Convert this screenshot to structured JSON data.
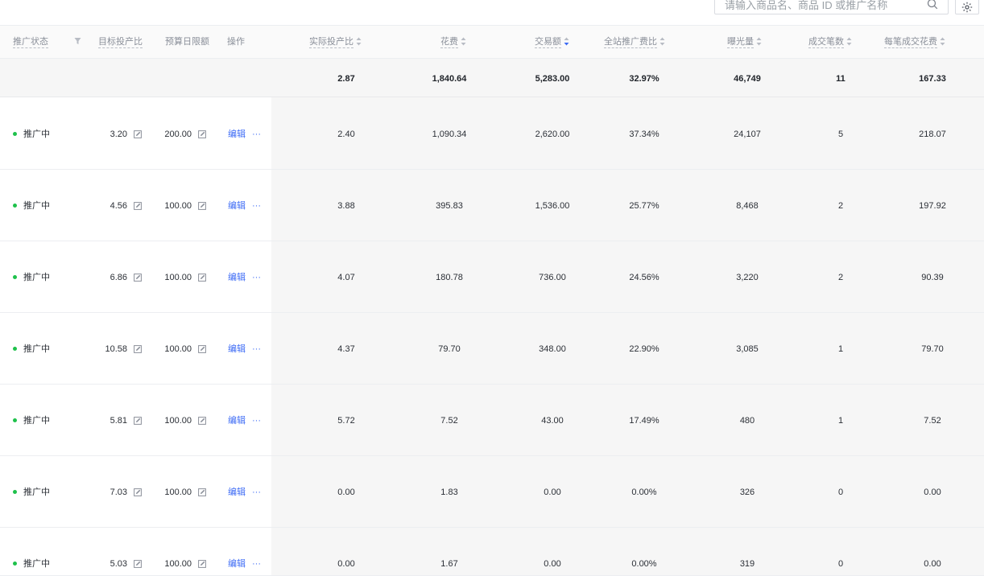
{
  "search": {
    "placeholder": "请输入商品名、商品 ID 或推广名称"
  },
  "colors": {
    "accent": "#3d6bf5",
    "status_active": "#1ec14b",
    "shade": "#f6f6f6"
  },
  "icons": {
    "search": "search-icon",
    "settings": "settings-icon",
    "filter": "filter-icon",
    "sort": "sort-icon",
    "edit": "edit-icon",
    "more": "more-icon"
  },
  "columns": {
    "status": "推广状态",
    "target_roi": "目标投产比",
    "daily_budget": "预算日限额",
    "action": "操作",
    "actual_roi": "实际投产比",
    "cost": "花费",
    "gmv": "交易额",
    "site_ratio": "全站推广费比",
    "impressions": "曝光量",
    "orders": "成交笔数",
    "cost_per_order": "每笔成交花费"
  },
  "summary": {
    "actual_roi": "2.87",
    "cost": "1,840.64",
    "gmv": "5,283.00",
    "site_ratio": "32.97%",
    "impressions": "46,749",
    "orders": "11",
    "cost_per_order": "167.33"
  },
  "rows": [
    {
      "status": "推广中",
      "target_roi": "3.20",
      "daily_budget": "200.00",
      "edit_label": "编辑",
      "more_label": "···",
      "actual_roi": "2.40",
      "cost": "1,090.34",
      "gmv": "2,620.00",
      "site_ratio": "37.34%",
      "impressions": "24,107",
      "orders": "5",
      "cost_per_order": "218.07"
    },
    {
      "status": "推广中",
      "target_roi": "4.56",
      "daily_budget": "100.00",
      "edit_label": "编辑",
      "more_label": "···",
      "actual_roi": "3.88",
      "cost": "395.83",
      "gmv": "1,536.00",
      "site_ratio": "25.77%",
      "impressions": "8,468",
      "orders": "2",
      "cost_per_order": "197.92"
    },
    {
      "status": "推广中",
      "target_roi": "6.86",
      "daily_budget": "100.00",
      "edit_label": "编辑",
      "more_label": "···",
      "actual_roi": "4.07",
      "cost": "180.78",
      "gmv": "736.00",
      "site_ratio": "24.56%",
      "impressions": "3,220",
      "orders": "2",
      "cost_per_order": "90.39"
    },
    {
      "status": "推广中",
      "target_roi": "10.58",
      "daily_budget": "100.00",
      "edit_label": "编辑",
      "more_label": "···",
      "actual_roi": "4.37",
      "cost": "79.70",
      "gmv": "348.00",
      "site_ratio": "22.90%",
      "impressions": "3,085",
      "orders": "1",
      "cost_per_order": "79.70"
    },
    {
      "status": "推广中",
      "target_roi": "5.81",
      "daily_budget": "100.00",
      "edit_label": "编辑",
      "more_label": "···",
      "actual_roi": "5.72",
      "cost": "7.52",
      "gmv": "43.00",
      "site_ratio": "17.49%",
      "impressions": "480",
      "orders": "1",
      "cost_per_order": "7.52"
    },
    {
      "status": "推广中",
      "target_roi": "7.03",
      "daily_budget": "100.00",
      "edit_label": "编辑",
      "more_label": "···",
      "actual_roi": "0.00",
      "cost": "1.83",
      "gmv": "0.00",
      "site_ratio": "0.00%",
      "impressions": "326",
      "orders": "0",
      "cost_per_order": "0.00"
    },
    {
      "status": "推广中",
      "target_roi": "5.03",
      "daily_budget": "100.00",
      "edit_label": "编辑",
      "more_label": "···",
      "actual_roi": "0.00",
      "cost": "1.67",
      "gmv": "0.00",
      "site_ratio": "0.00%",
      "impressions": "319",
      "orders": "0",
      "cost_per_order": "0.00"
    }
  ]
}
